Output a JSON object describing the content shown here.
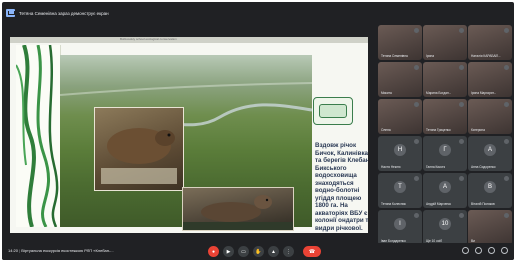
{
  "topbar": {
    "presenter_label": "Тетяна Семенівна зараз демонструє екран"
  },
  "slide": {
    "header_text": "Bobkovskiy school ecological conservation",
    "text": "Вздовж річок Бичок, Калинівка та берегів Клебан-Бикського водосховища знаходяться водно-болотні угіддя площею 1800 га. На акваторіях ВБУ є колонії ондатри та видри річкової."
  },
  "participants": [
    {
      "name": "Тетяна Семенівна",
      "video": true
    },
    {
      "name": "Ірина",
      "video": true
    },
    {
      "name": "Наталія КАРАБАЙ...",
      "video": true
    },
    {
      "name": "Микита",
      "video": true
    },
    {
      "name": "Марина Богдан...",
      "video": true
    },
    {
      "name": "Ірина Маргарит...",
      "video": true
    },
    {
      "name": "Олена",
      "video": true
    },
    {
      "name": "Тетяна Гриценко",
      "video": true
    },
    {
      "name": "Катерина",
      "video": true
    },
    {
      "name": "Настя Неклю",
      "video": false,
      "initial": "Н"
    },
    {
      "name": "Ганна Кикоть",
      "video": false,
      "initial": "Г"
    },
    {
      "name": "Анна Сидоренко",
      "video": false,
      "initial": "А"
    },
    {
      "name": "Тетяна Колесник",
      "video": false,
      "initial": "Т"
    },
    {
      "name": "Андрій Марченко",
      "video": false,
      "initial": "А"
    },
    {
      "name": "Віталій Поляков",
      "video": false,
      "initial": "В"
    },
    {
      "name": "Іван Бондаренко",
      "video": false,
      "initial": "І"
    },
    {
      "name": "Ще 10 осіб",
      "video": false,
      "initial": "10"
    },
    {
      "name": "Ви",
      "video": true
    }
  ],
  "bottombar": {
    "time": "14:20",
    "meeting_title": "Віртуальна екскурсія екостежкою РЛП «Клебан-...",
    "controls": [
      "mic-icon",
      "camera-icon",
      "captions-icon",
      "raise-hand-icon",
      "present-icon",
      "more-icon",
      "end-call-icon"
    ]
  }
}
